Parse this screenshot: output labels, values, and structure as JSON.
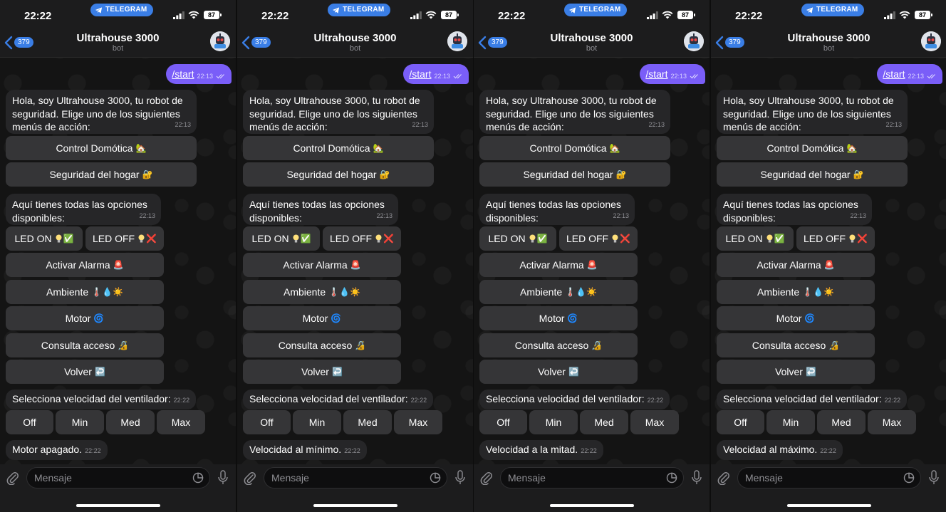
{
  "status_bar": {
    "time": "22:22",
    "return_app": "TELEGRAM",
    "battery": "87"
  },
  "header": {
    "back_count": "379",
    "title": "Ultrahouse 3000",
    "subtitle": "bot"
  },
  "outgoing": {
    "text": "/start",
    "time": "22:13"
  },
  "welcome": {
    "text": "Hola, soy Ultrahouse 3000, tu robot de seguridad. Elige uno de los siguientes menús de acción:",
    "time": "22:13",
    "buttons": [
      {
        "label": "Control Domótica",
        "emoji": "🏡"
      },
      {
        "label": "Seguridad del hogar",
        "emoji": "🔐"
      }
    ]
  },
  "options": {
    "text": "Aquí tienes todas las opciones disponibles:",
    "time": "22:13",
    "led_on": {
      "label": "LED ON",
      "emoji": "✅"
    },
    "led_off": {
      "label": "LED OFF",
      "emoji": "❌"
    },
    "buttons": [
      {
        "label": "Activar Alarma",
        "emoji": "🚨"
      },
      {
        "label": "Ambiente",
        "emoji": "🌡️💧☀️"
      },
      {
        "label": "Motor",
        "emoji": "🌀"
      },
      {
        "label": "Consulta acceso",
        "emoji": "🔏"
      },
      {
        "label": "Volver",
        "emoji": "↩️"
      }
    ]
  },
  "fan": {
    "text": "Selecciona velocidad del ventilador:",
    "time": "22:22",
    "speeds": [
      "Off",
      "Min",
      "Med",
      "Max"
    ]
  },
  "screens": [
    {
      "response": "Motor apagado.",
      "time": "22:22"
    },
    {
      "response": "Velocidad al mínimo.",
      "time": "22:22"
    },
    {
      "response": "Velocidad a la mitad.",
      "time": "22:22"
    },
    {
      "response": "Velocidad al máximo.",
      "time": "22:22"
    }
  ],
  "input": {
    "placeholder": "Mensaje"
  },
  "colors": {
    "accent": "#3a7ee6",
    "outgoing_bubble": "#7a5ef8",
    "bubble": "#262628",
    "button": "#353537"
  },
  "icons": [
    "telegram-icon",
    "back-chevron-icon",
    "bot-avatar-icon",
    "read-check-icon",
    "paperclip-icon",
    "sticker-icon",
    "microphone-icon",
    "bulb-icon"
  ]
}
